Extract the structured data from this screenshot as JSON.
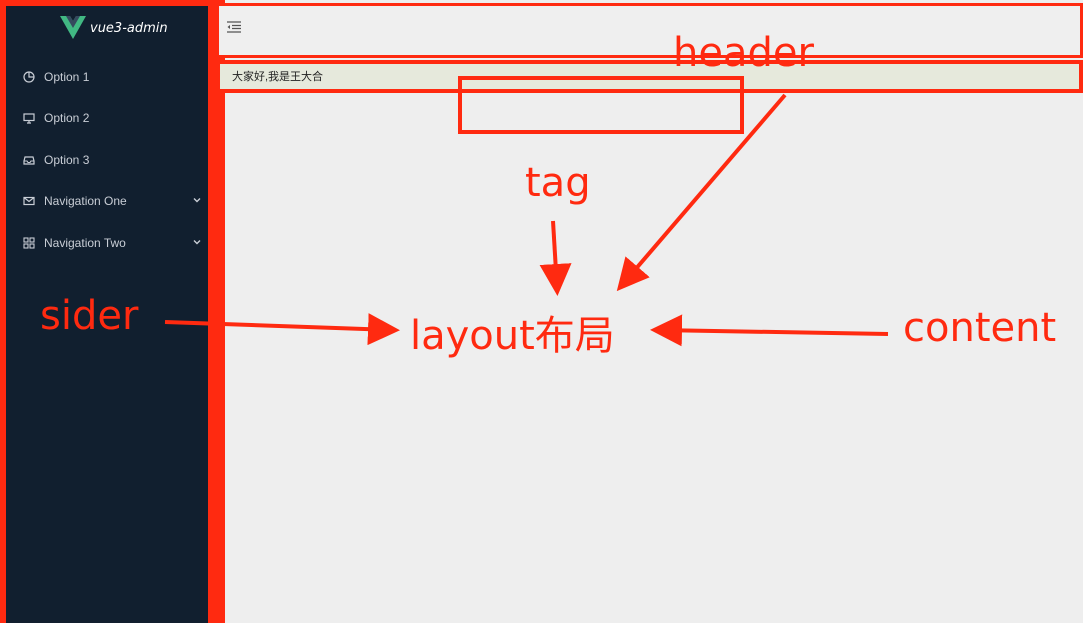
{
  "brand": {
    "name": "vue3-admin",
    "logo": "vue-logo-icon"
  },
  "sidebar": {
    "items": [
      {
        "label": "Option 1",
        "icon": "pie-chart-icon",
        "expandable": false
      },
      {
        "label": "Option 2",
        "icon": "desktop-icon",
        "expandable": false
      },
      {
        "label": "Option 3",
        "icon": "inbox-icon",
        "expandable": false
      },
      {
        "label": "Navigation One",
        "icon": "mail-icon",
        "expandable": true
      },
      {
        "label": "Navigation Two",
        "icon": "appstore-icon",
        "expandable": true
      }
    ]
  },
  "header": {
    "toggle_icon": "menu-fold-icon"
  },
  "tagbar": {
    "text": "大家好,我是王大合"
  },
  "annotations": {
    "header": "header",
    "tag": "tag",
    "sider": "sider",
    "layout": "layout布局",
    "content": "content"
  },
  "colors": {
    "sider_bg": "#111f2f",
    "annotation_red": "#ff2a10",
    "content_bg": "#eeeeee",
    "tagbar_bg": "#e6e9dc"
  }
}
